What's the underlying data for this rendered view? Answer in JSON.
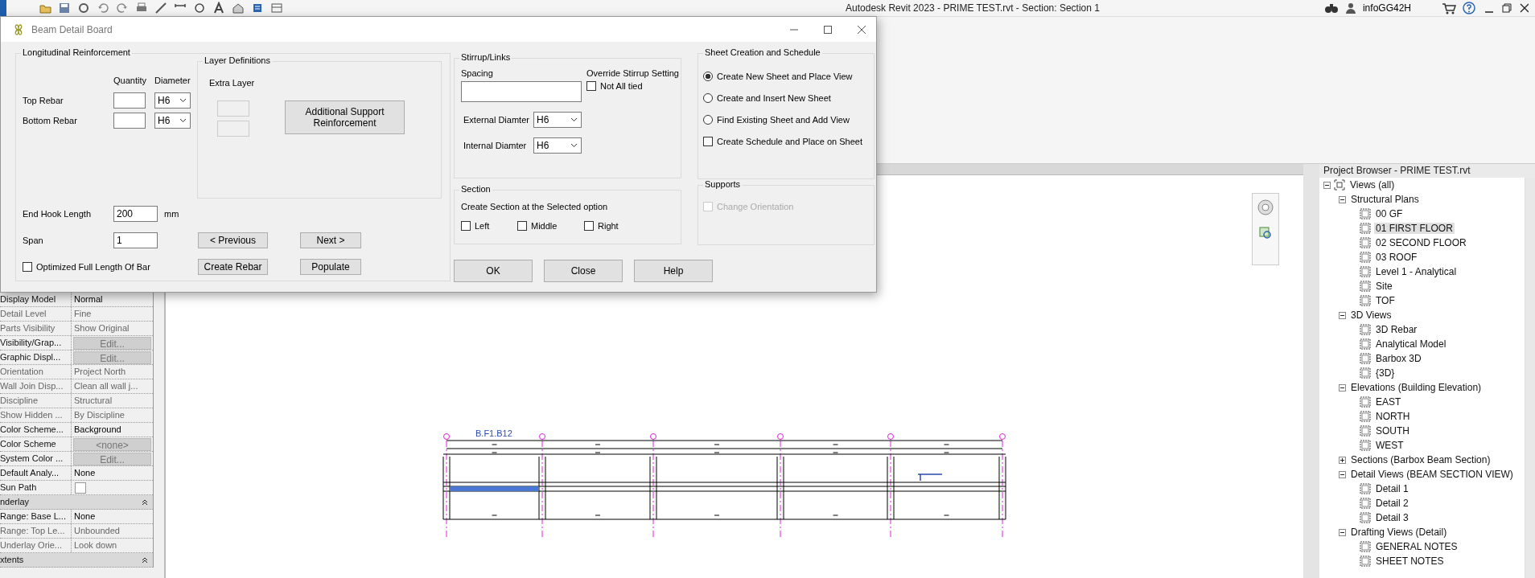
{
  "app": {
    "title": "Autodesk Revit 2023 - PRIME TEST.rvt - Section: Section 1",
    "user": "infoGG42H"
  },
  "dialog": {
    "title": "Beam Detail Board",
    "longitudinal": {
      "title": "Longitudinal Reinforcement",
      "quantity_header": "Quantity",
      "diameter_header": "Diameter",
      "rows": [
        {
          "label": "Top Rebar",
          "diameter": "H6"
        },
        {
          "label": "Bottom Rebar",
          "diameter": "H6"
        }
      ],
      "end_hook": {
        "label": "End Hook Length",
        "value": "200",
        "unit": "mm"
      },
      "span": {
        "label": "Span",
        "value": "1"
      },
      "optimized": {
        "label": "Optimized Full Length Of Bar",
        "checked": false
      }
    },
    "layers": {
      "title": "Layer Definitions",
      "extra_layer": "Extra Layer",
      "support_button": "Additional Support Reinforcement"
    },
    "nav_buttons": [
      "< Previous",
      "Next >",
      "Create Rebar",
      "Populate"
    ],
    "stirrups": {
      "title": "Stirrup/Links",
      "spacing_label": "Spacing",
      "override_label": "Override Stirrup Setting",
      "not_all_tied": {
        "label": "Not All tied",
        "checked": false
      },
      "external": {
        "label": "External Diamter",
        "value": "H6"
      },
      "internal": {
        "label": "Internal Diamter",
        "value": "H6"
      }
    },
    "section": {
      "title": "Section",
      "caption": "Create Section at the Selected  option",
      "options": [
        {
          "label": "Left",
          "checked": false
        },
        {
          "label": "Middle",
          "checked": false
        },
        {
          "label": "Right",
          "checked": false
        }
      ]
    },
    "sheet": {
      "title": "Sheet Creation and Schedule",
      "options": [
        {
          "kind": "radio",
          "label": "Create New Sheet and Place View",
          "selected": true
        },
        {
          "kind": "radio",
          "label": "Create  and Insert New Sheet",
          "selected": false
        },
        {
          "kind": "radio",
          "label": "Find Existing Sheet and Add View",
          "selected": false
        },
        {
          "kind": "checkbox",
          "label": "Create Schedule and Place on Sheet",
          "checked": false
        }
      ]
    },
    "supports": {
      "title": "Supports",
      "change_orientation": {
        "label": "Change Orientation",
        "checked": false,
        "disabled": true
      }
    },
    "buttons": [
      "OK",
      "Close",
      "Help"
    ]
  },
  "properties": {
    "rows": [
      {
        "kind": "text",
        "label": "Display Model",
        "value": "Normal",
        "disabled": false
      },
      {
        "kind": "text",
        "label": "Detail Level",
        "value": "Fine",
        "disabled": true
      },
      {
        "kind": "text",
        "label": "Parts Visibility",
        "value": "Show Original",
        "disabled": true
      },
      {
        "kind": "button",
        "label": "Visibility/Grap...",
        "value": "Edit..."
      },
      {
        "kind": "button",
        "label": "Graphic Displ...",
        "value": "Edit..."
      },
      {
        "kind": "text",
        "label": "Orientation",
        "value": "Project North",
        "disabled": true
      },
      {
        "kind": "text",
        "label": "Wall Join Disp...",
        "value": "Clean all wall j...",
        "disabled": true
      },
      {
        "kind": "text",
        "label": "Discipline",
        "value": "Structural",
        "disabled": true
      },
      {
        "kind": "text",
        "label": "Show Hidden ...",
        "value": "By Discipline",
        "disabled": true
      },
      {
        "kind": "text",
        "label": "Color Scheme...",
        "value": "Background",
        "disabled": false
      },
      {
        "kind": "button",
        "label": "Color Scheme",
        "value": "<none>"
      },
      {
        "kind": "button",
        "label": "System Color ...",
        "value": "Edit..."
      },
      {
        "kind": "text",
        "label": "Default Analy...",
        "value": "None",
        "disabled": false
      },
      {
        "kind": "checkbox",
        "label": "Sun Path",
        "checked": false
      },
      {
        "kind": "group",
        "label": "nderlay"
      },
      {
        "kind": "text",
        "label": "Range: Base L...",
        "value": "None",
        "disabled": false
      },
      {
        "kind": "text",
        "label": "Range: Top Le...",
        "value": "Unbounded",
        "disabled": true
      },
      {
        "kind": "text",
        "label": "Underlay Orie...",
        "value": "Look down",
        "disabled": true
      },
      {
        "kind": "group",
        "label": "xtents"
      }
    ]
  },
  "canvas": {
    "beam_tag": "B.F1.B12"
  },
  "browser": {
    "title": "Project Browser - PRIME TEST.rvt",
    "tree": [
      {
        "kind": "root",
        "label": "Views (all)",
        "expanded": true,
        "selected": false,
        "children": [
          {
            "kind": "group",
            "label": "Structural Plans",
            "expanded": true,
            "selected": false,
            "children": [
              {
                "kind": "view",
                "label": "00 GF",
                "selected": false
              },
              {
                "kind": "view",
                "label": "01 FIRST FLOOR",
                "selected": true
              },
              {
                "kind": "view",
                "label": "02 SECOND FLOOR",
                "selected": false
              },
              {
                "kind": "view",
                "label": "03 ROOF",
                "selected": false
              },
              {
                "kind": "view",
                "label": "Level 1 - Analytical",
                "selected": false
              },
              {
                "kind": "view",
                "label": "Site",
                "selected": false
              },
              {
                "kind": "view",
                "label": "TOF",
                "selected": false
              }
            ]
          },
          {
            "kind": "group",
            "label": "3D Views",
            "expanded": true,
            "selected": false,
            "children": [
              {
                "kind": "view",
                "label": "3D Rebar",
                "selected": false
              },
              {
                "kind": "view",
                "label": "Analytical Model",
                "selected": false
              },
              {
                "kind": "view",
                "label": "Barbox 3D",
                "selected": false
              },
              {
                "kind": "view",
                "label": "{3D}",
                "selected": false
              }
            ]
          },
          {
            "kind": "group",
            "label": "Elevations (Building Elevation)",
            "expanded": true,
            "selected": false,
            "children": [
              {
                "kind": "view",
                "label": "EAST",
                "selected": false
              },
              {
                "kind": "view",
                "label": "NORTH",
                "selected": false
              },
              {
                "kind": "view",
                "label": "SOUTH",
                "selected": false
              },
              {
                "kind": "view",
                "label": "WEST",
                "selected": false
              }
            ]
          },
          {
            "kind": "group",
            "label": "Sections (Barbox Beam Section)",
            "expanded": false,
            "selected": false
          },
          {
            "kind": "group",
            "label": "Detail Views (BEAM SECTION VIEW)",
            "expanded": true,
            "selected": false,
            "children": [
              {
                "kind": "view",
                "label": "Detail 1",
                "selected": false
              },
              {
                "kind": "view",
                "label": "Detail 2",
                "selected": false
              },
              {
                "kind": "view",
                "label": "Detail 3",
                "selected": false
              }
            ]
          },
          {
            "kind": "group",
            "label": "Drafting Views (Detail)",
            "expanded": true,
            "selected": false,
            "children": [
              {
                "kind": "view",
                "label": "GENERAL NOTES",
                "selected": false
              },
              {
                "kind": "view",
                "label": "SHEET NOTES",
                "selected": false
              }
            ]
          }
        ]
      }
    ]
  }
}
